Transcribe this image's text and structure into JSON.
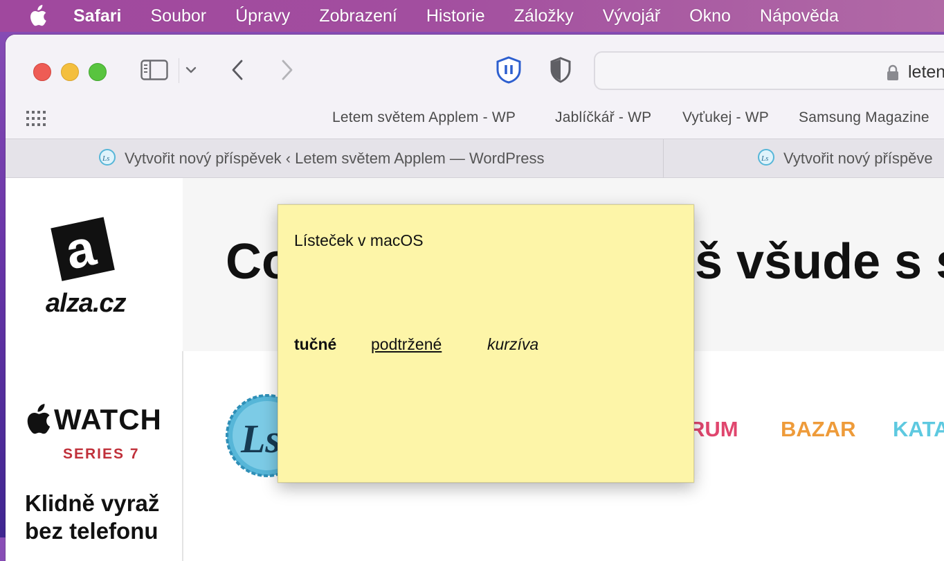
{
  "menubar": {
    "app_name": "Safari",
    "items": [
      "Soubor",
      "Úpravy",
      "Zobrazení",
      "Historie",
      "Záložky",
      "Vývojář",
      "Okno",
      "Nápověda"
    ]
  },
  "toolbar": {
    "address_text": "leten"
  },
  "favorites": [
    "Letem světem Applem - WP",
    "Jablíčkář - WP",
    "Vyťukej - WP",
    "Samsung Magazine"
  ],
  "tabs": [
    {
      "title": "Vytvořit nový příspěvek ‹ Letem světem Applem — WordPress"
    },
    {
      "title": "Vytvořit nový příspěve"
    }
  ],
  "page": {
    "alza_text": "alza.cz",
    "headline_left": "Co",
    "headline_right": "š všude s s",
    "watch_word": "WATCH",
    "series": "SERIES 7",
    "ad_line1": "Klidně vyraž",
    "ad_line2": "bez telefonu",
    "nav": [
      {
        "label": "RUM",
        "color": "#e0466e"
      },
      {
        "label": "BAZAR",
        "color": "#ee9b3a"
      },
      {
        "label": "KATA",
        "color": "#5ec9e0"
      }
    ]
  },
  "sticky_note": {
    "title": "Lísteček v macOS",
    "bold_text": "tučné",
    "underline_text": "podtržené",
    "italic_text": "kurzíva",
    "background": "#fdf5a8"
  }
}
